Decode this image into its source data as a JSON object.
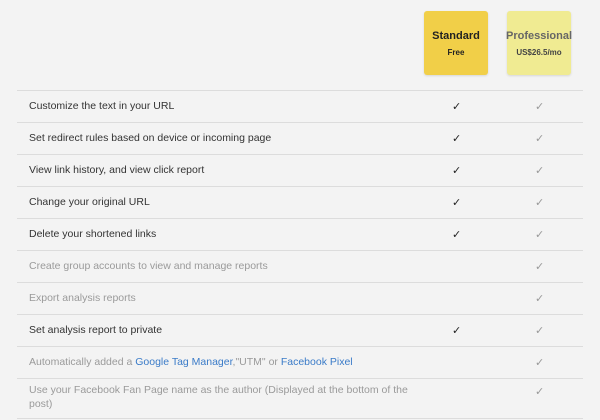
{
  "plans": {
    "standard": {
      "name": "Standard",
      "price": "Free"
    },
    "professional": {
      "name": "Professional",
      "price": "US$26.5/mo"
    }
  },
  "check_mark": "✓",
  "features": [
    {
      "label": "Customize the text in your URL",
      "standard": true,
      "professional": true,
      "muted": false
    },
    {
      "label": "Set redirect rules based on device or incoming page",
      "standard": true,
      "professional": true,
      "muted": false
    },
    {
      "label": "View link history, and view click report",
      "standard": true,
      "professional": true,
      "muted": false
    },
    {
      "label": "Change your original URL",
      "standard": true,
      "professional": true,
      "muted": false
    },
    {
      "label": "Delete your shortened links",
      "standard": true,
      "professional": true,
      "muted": false
    },
    {
      "label": "Create group accounts to view and manage reports",
      "standard": false,
      "professional": true,
      "muted": true
    },
    {
      "label": "Export analysis reports",
      "standard": false,
      "professional": true,
      "muted": true
    },
    {
      "label": "Set analysis report to private",
      "standard": true,
      "professional": true,
      "muted": false
    },
    {
      "label_prefix": "Automatically added a ",
      "link1": "Google Tag Manager",
      "label_mid": ",\"UTM\" or ",
      "link2": "Facebook Pixel",
      "standard": false,
      "professional": true,
      "muted": true
    },
    {
      "label": "Use your Facebook Fan Page name as the author (Displayed at the bottom of the post)",
      "standard": false,
      "professional": true,
      "muted": true
    }
  ]
}
